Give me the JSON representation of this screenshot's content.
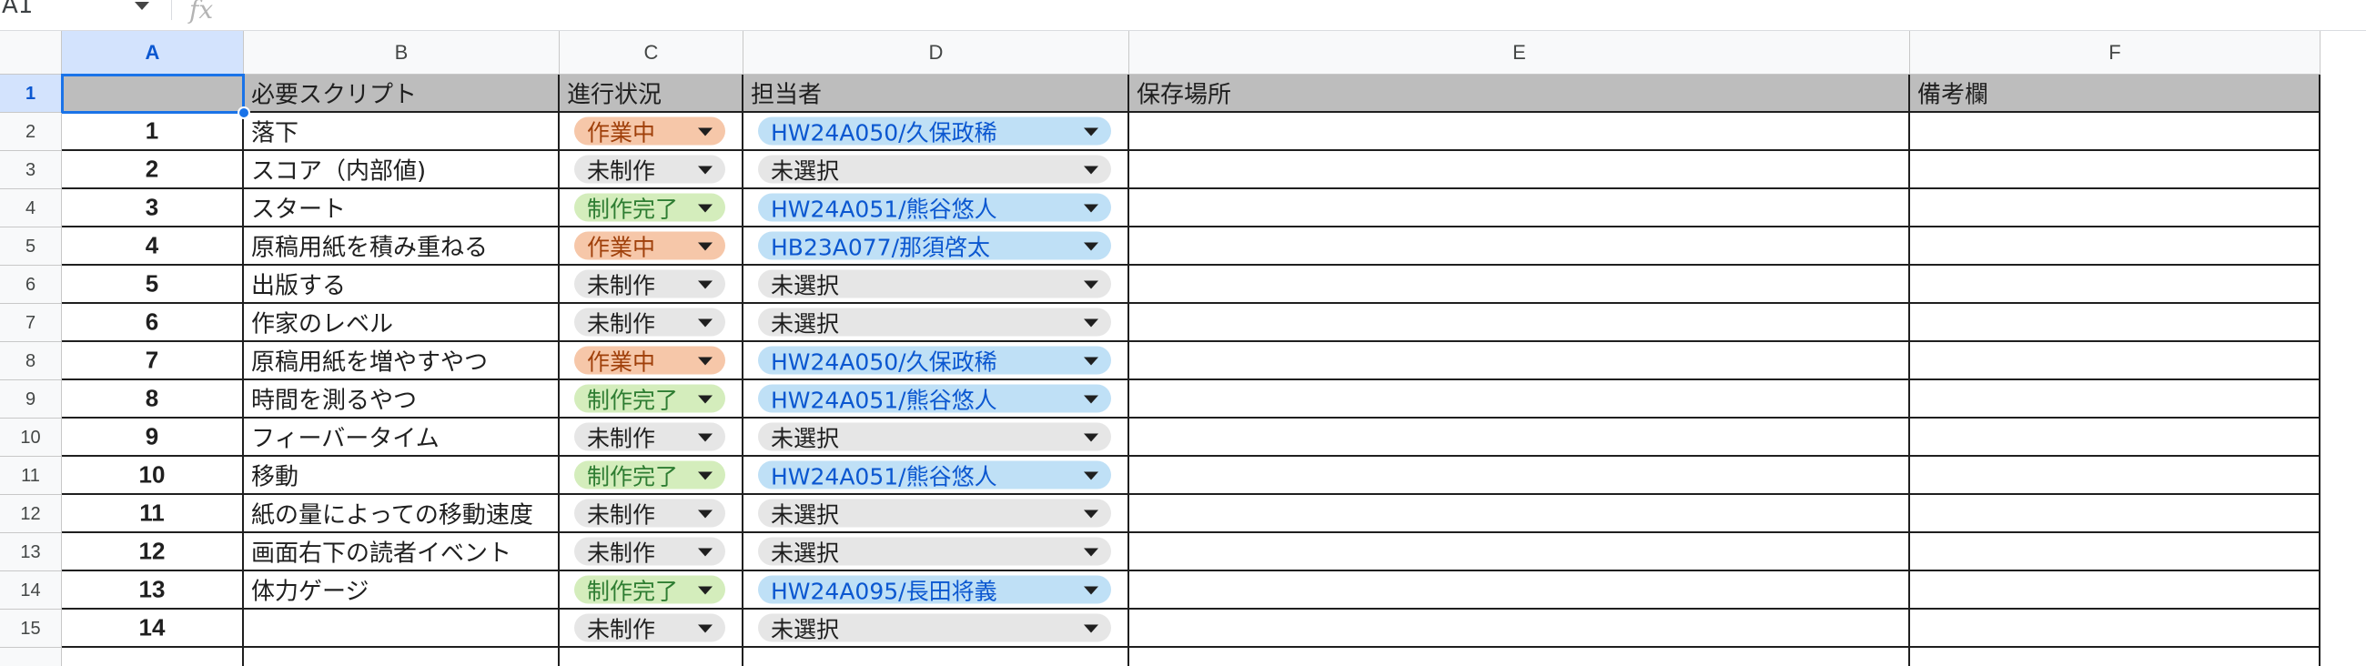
{
  "formula_bar": {
    "name_box": "A1",
    "fx_icon": "function-fx-icon"
  },
  "columns": [
    "A",
    "B",
    "C",
    "D",
    "E",
    "F"
  ],
  "selected_cell": "A1",
  "header_row": {
    "row_number": "1",
    "A": "",
    "B": "必要スクリプト",
    "C": "進行状況",
    "D": "担当者",
    "E": "保存場所",
    "F": "備考欄"
  },
  "status_colors": {
    "作業中": {
      "bg": "#f6c7a9",
      "fg": "#a0400b"
    },
    "未制作": {
      "bg": "#e6e6e6",
      "fg": "#1f1f1f"
    },
    "制作完了": {
      "bg": "#d4edbc",
      "fg": "#2e7d32"
    }
  },
  "assignee_colors": {
    "assigned": {
      "bg": "#bfe0f6",
      "fg": "#0b57d0"
    },
    "unassigned": {
      "bg": "#e6e6e6",
      "fg": "#1f1f1f"
    }
  },
  "rows": [
    {
      "row_number": "2",
      "no": "1",
      "script": "落下",
      "status": "作業中",
      "assignee": "HW24A050/久保政稀",
      "assigned": true
    },
    {
      "row_number": "3",
      "no": "2",
      "script": "スコア（内部値)",
      "status": "未制作",
      "assignee": "未選択",
      "assigned": false
    },
    {
      "row_number": "4",
      "no": "3",
      "script": "スタート",
      "status": "制作完了",
      "assignee": "HW24A051/熊谷悠人",
      "assigned": true
    },
    {
      "row_number": "5",
      "no": "4",
      "script": "原稿用紙を積み重ねる",
      "status": "作業中",
      "assignee": "HB23A077/那須啓太",
      "assigned": true
    },
    {
      "row_number": "6",
      "no": "5",
      "script": "出版する",
      "status": "未制作",
      "assignee": "未選択",
      "assigned": false
    },
    {
      "row_number": "7",
      "no": "6",
      "script": "作家のレベル",
      "status": "未制作",
      "assignee": "未選択",
      "assigned": false
    },
    {
      "row_number": "8",
      "no": "7",
      "script": "原稿用紙を増やすやつ",
      "status": "作業中",
      "assignee": "HW24A050/久保政稀",
      "assigned": true
    },
    {
      "row_number": "9",
      "no": "8",
      "script": "時間を測るやつ",
      "status": "制作完了",
      "assignee": "HW24A051/熊谷悠人",
      "assigned": true
    },
    {
      "row_number": "10",
      "no": "9",
      "script": "フィーバータイム",
      "status": "未制作",
      "assignee": "未選択",
      "assigned": false
    },
    {
      "row_number": "11",
      "no": "10",
      "script": "移動",
      "status": "制作完了",
      "assignee": "HW24A051/熊谷悠人",
      "assigned": true
    },
    {
      "row_number": "12",
      "no": "11",
      "script": "紙の量によっての移動速度",
      "status": "未制作",
      "assignee": "未選択",
      "assigned": false
    },
    {
      "row_number": "13",
      "no": "12",
      "script": "画面右下の読者イベント",
      "status": "未制作",
      "assignee": "未選択",
      "assigned": false
    },
    {
      "row_number": "14",
      "no": "13",
      "script": "体力ゲージ",
      "status": "制作完了",
      "assignee": "HW24A095/長田将義",
      "assigned": true
    },
    {
      "row_number": "15",
      "no": "14",
      "script": "",
      "status": "未制作",
      "assignee": "未選択",
      "assigned": false
    }
  ]
}
